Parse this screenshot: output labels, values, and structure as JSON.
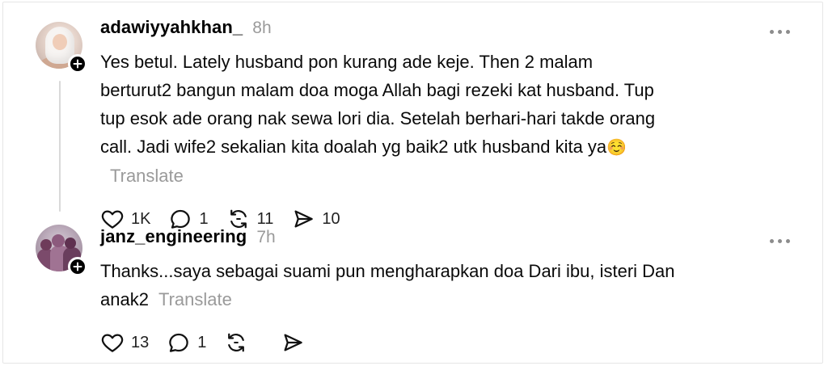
{
  "posts": [
    {
      "username": "adawiyyahkhan_",
      "time": "8h",
      "avatar_icon": "profile-photo-hijab",
      "text": "Yes betul. Lately husband pon kurang ade keje. Then 2 malam berturut2 bangun malam doa moga Allah bagi rezeki kat husband. Tup tup esok ade orang nak sewa lori dia. Setelah berhari-hari takde orang call. Jadi wife2 sekalian kita doalah yg baik2 utk husband kita ya",
      "emoji": "☺️",
      "translate_label": "Translate",
      "likes": "1K",
      "replies": "1",
      "reposts": "11",
      "shares": "10"
    },
    {
      "username": "janz_engineering",
      "time": "7h",
      "avatar_icon": "profile-photo-group",
      "text": "Thanks...saya sebagai suami pun mengharapkan doa Dari ibu, isteri Dan anak2",
      "translate_label": "Translate",
      "likes": "13",
      "replies": "1",
      "reposts": "",
      "shares": ""
    }
  ],
  "icons": {
    "like": "heart-icon",
    "reply": "comment-icon",
    "repost": "repost-icon",
    "share": "send-icon",
    "follow": "plus-icon",
    "more": "more-horizontal-icon"
  },
  "colors": {
    "text": "#000000",
    "muted": "#9a9a9a",
    "thread_line": "#d9d9d9"
  }
}
